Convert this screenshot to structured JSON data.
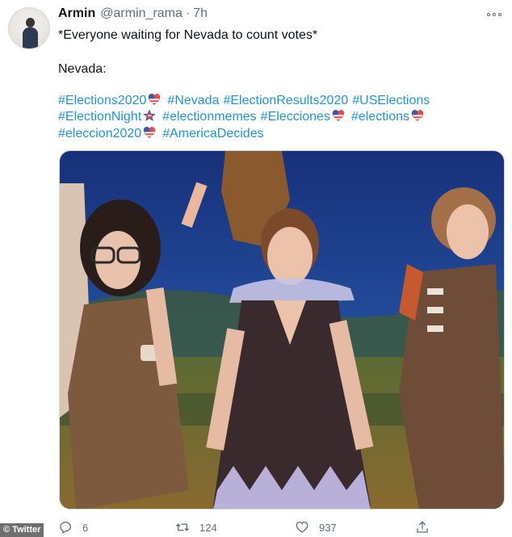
{
  "tweet": {
    "display_name": "Armin",
    "handle": "@armin_rama",
    "separator": "·",
    "time": "7h",
    "line1": "*Everyone waiting for Nevada to count votes*",
    "line2": "Nevada:",
    "hashtags_row1": [
      {
        "text": "#Elections2020",
        "emoji": "usa-heart-icon"
      },
      {
        "text": "#Nevada",
        "emoji": ""
      },
      {
        "text": "#ElectionResults2020",
        "emoji": ""
      },
      {
        "text": "#USElections",
        "emoji": ""
      }
    ],
    "hashtags_row2": [
      {
        "text": "#ElectionNight",
        "emoji": "usa-star-icon"
      },
      {
        "text": "#electionmemes",
        "emoji": ""
      },
      {
        "text": "#Elecciones",
        "emoji": "usa-heart-icon"
      },
      {
        "text": "#elections",
        "emoji": "usa-heart-icon"
      }
    ],
    "hashtags_row3": [
      {
        "text": "#eleccion2020",
        "emoji": "usa-heart-icon"
      },
      {
        "text": "#AmericaDecides",
        "emoji": ""
      }
    ]
  },
  "actions": {
    "reply_count": "6",
    "retweet_count": "124",
    "like_count": "937"
  },
  "credit": "© Twitter",
  "colors": {
    "hashtag": "#1b95e0",
    "secondary_text": "#5b7083",
    "primary_text": "#0f1419"
  }
}
